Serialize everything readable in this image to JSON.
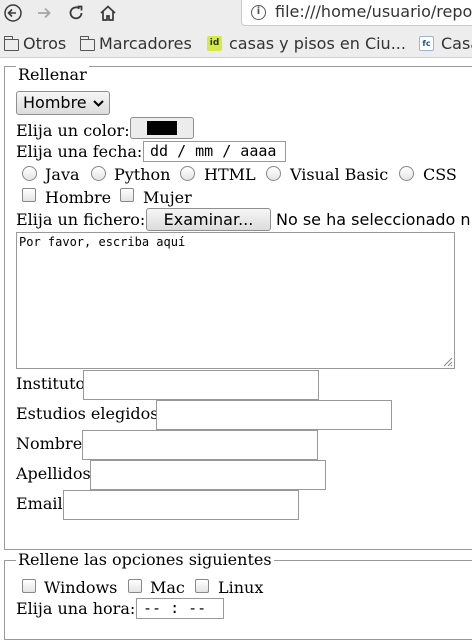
{
  "browser": {
    "url": "file:///home/usuario/repo",
    "bookmarks": [
      "Otros",
      "Marcadores",
      "casas y pisos en Ciu...",
      "Casa"
    ],
    "favicon_labels": [
      "id",
      "fc"
    ]
  },
  "form": {
    "legend": "Rellenar",
    "gender_select": "Hombre",
    "color_label": "Elija un color:",
    "color_value": "#000000",
    "date_label": "Elija una fecha:",
    "date_placeholder": "dd / mm / aaaa",
    "languages": [
      "Java",
      "Python",
      "HTML",
      "Visual Basic",
      "CSS"
    ],
    "genders": [
      "Hombre",
      "Mujer"
    ],
    "file_label": "Elija un fichero:",
    "file_button": "Examinar...",
    "file_status": "No se ha seleccionado ni",
    "textarea_text": "Por favor, escriba aquí",
    "text_fields": [
      "Instituto",
      "Estudios elegidos",
      "Nombre",
      "Apellidos",
      "Email"
    ]
  },
  "options": {
    "legend": "Rellene las opciones siguientes",
    "os": [
      "Windows",
      "Mac",
      "Linux"
    ],
    "time_label": "Elija una hora:",
    "time_placeholder": "-- : --"
  }
}
